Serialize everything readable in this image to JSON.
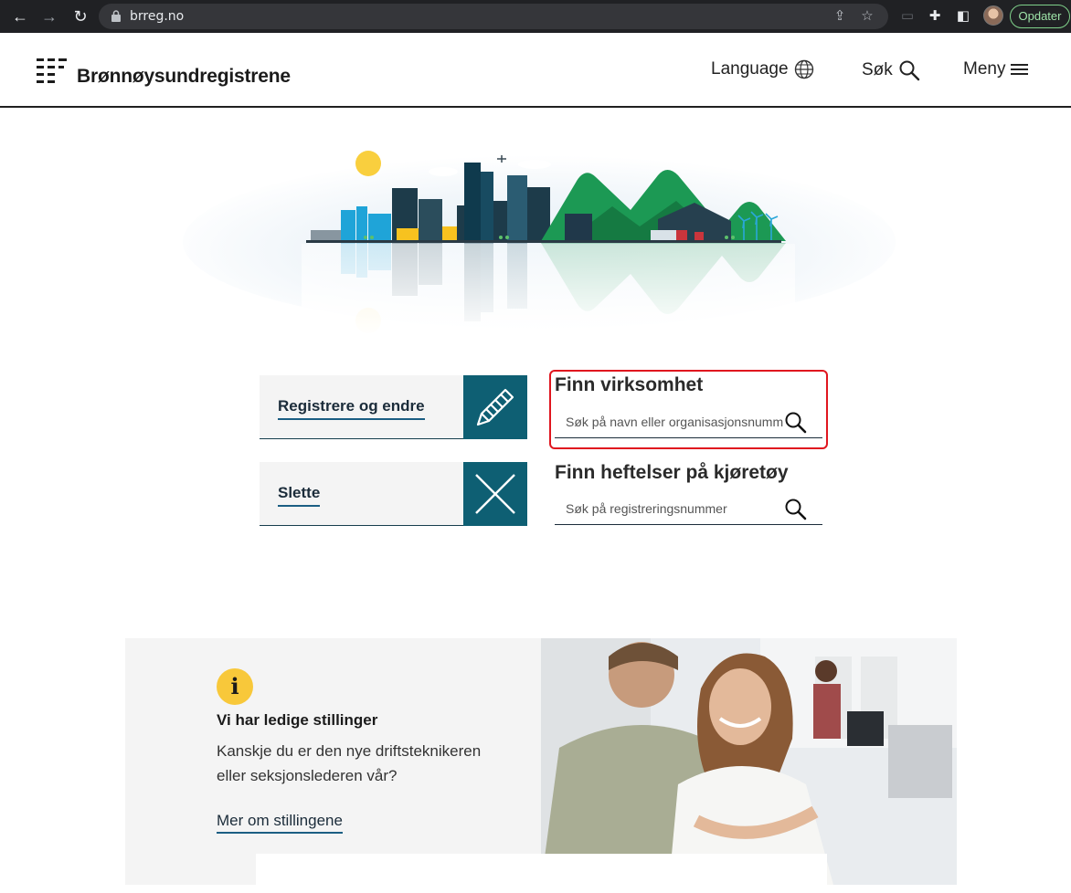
{
  "browser": {
    "url": "brreg.no",
    "update_label": "Opdater"
  },
  "header": {
    "logo_text": "Brønnøysundregistrene",
    "language_label": "Language",
    "search_label": "Søk",
    "menu_label": "Meny"
  },
  "actions": [
    {
      "label": "Registrere og endre",
      "icon": "pencil-icon"
    },
    {
      "label": "Slette",
      "icon": "close-x-icon"
    }
  ],
  "search_business": {
    "title": "Finn virksomhet",
    "placeholder": "Søk på navn eller organisasjonsnummer"
  },
  "search_vehicle": {
    "title": "Finn heftelser på kjøretøy",
    "placeholder": "Søk på registreringsnummer"
  },
  "jobs": {
    "icon_text": "i",
    "title": "Vi har ledige stillinger",
    "body": "Kanskje du er den nye driftsteknikeren eller seksjonslederen vår?",
    "link": "Mer om stillingene"
  },
  "colors": {
    "accent_teal": "#0e5f73",
    "link_underline": "#1b5e83",
    "badge_yellow": "#f8c83a",
    "highlight_red": "#e0161f"
  }
}
